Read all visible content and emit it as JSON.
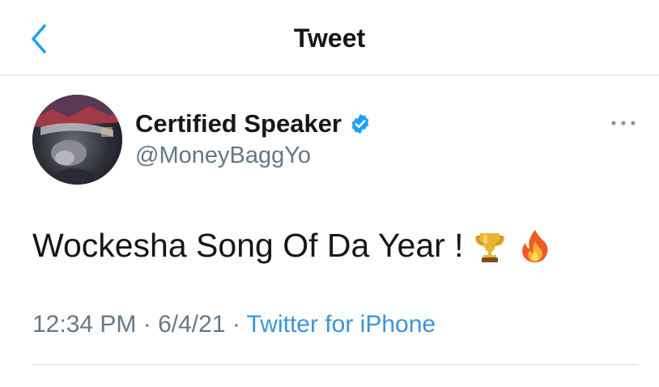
{
  "header": {
    "title": "Tweet",
    "back_icon": "chevron-left-icon",
    "accent_color": "#1da1f2"
  },
  "author": {
    "display_name": "Certified Speaker",
    "handle": "@MoneyBaggYo",
    "verified": true,
    "verified_icon": "verified-badge-icon",
    "avatar": "avatar-photo"
  },
  "more_icon": "more-horizontal-icon",
  "tweet": {
    "text": "Wockesha Song Of Da Year !",
    "emojis": [
      "trophy-emoji",
      "fire-emoji"
    ]
  },
  "meta": {
    "time": "12:34 PM",
    "sep1": " · ",
    "date": "6/4/21",
    "sep2": " · ",
    "source": "Twitter for iPhone"
  },
  "colors": {
    "text": "#14171a",
    "secondary": "#657786",
    "link": "#3b94d9",
    "divider": "#d6d9dc"
  }
}
